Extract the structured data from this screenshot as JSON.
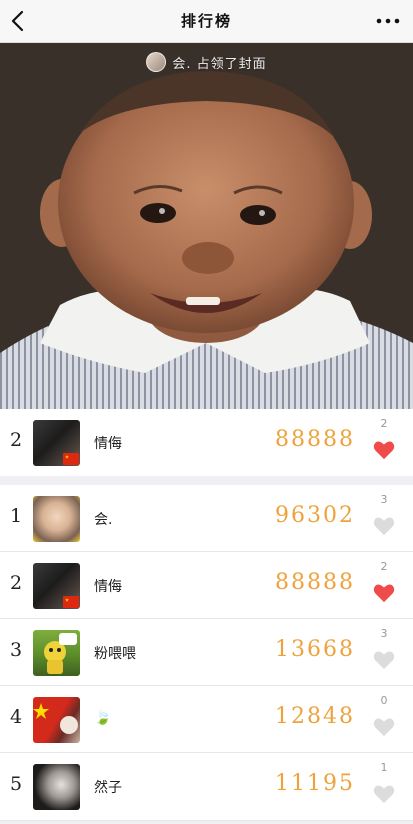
{
  "nav": {
    "title": "排行榜"
  },
  "cover": {
    "caption": "会. 占领了封面"
  },
  "my_row": {
    "rank": "2",
    "name": "情侮",
    "steps": "88888",
    "likes": "2",
    "liked": true
  },
  "rows": [
    {
      "rank": "1",
      "name": "会.",
      "steps": "96302",
      "likes": "3",
      "liked": false
    },
    {
      "rank": "2",
      "name": "情侮",
      "steps": "88888",
      "likes": "2",
      "liked": true
    },
    {
      "rank": "3",
      "name": "粉喂喂",
      "steps": "13668",
      "likes": "3",
      "liked": false
    },
    {
      "rank": "4",
      "name": "🍃",
      "steps": "12848",
      "likes": "0",
      "liked": false
    },
    {
      "rank": "5",
      "name": "然子",
      "steps": "11195",
      "likes": "1",
      "liked": false
    }
  ],
  "colors": {
    "steps": "#eda33c",
    "heart_on": "#f04b4b",
    "heart_off": "#dcdcdc"
  }
}
